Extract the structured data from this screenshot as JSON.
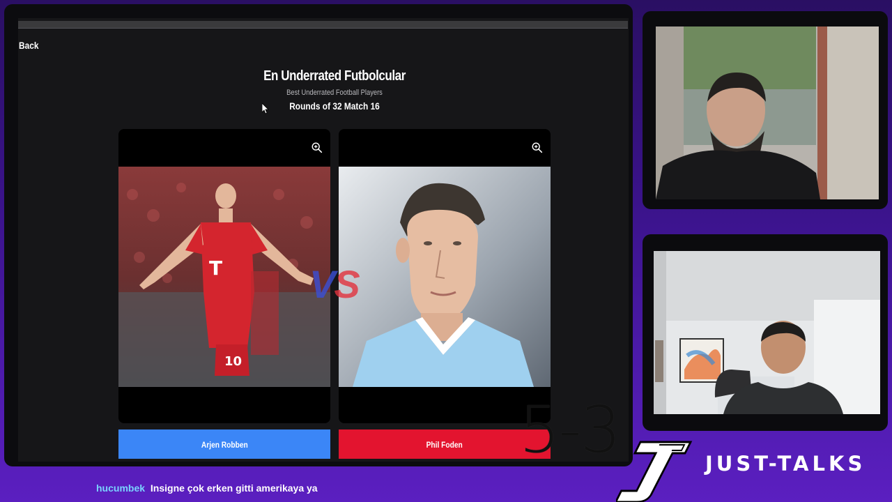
{
  "app": {
    "back_label": "Back",
    "title": "En Underrated Futbolcular",
    "subtitle": "Best Underrated Football Players",
    "round": "Rounds of 32 Match 16"
  },
  "matchup": {
    "vs_label_v": "V",
    "vs_label_s": "S",
    "left": {
      "name": "Arjen Robben",
      "color": "#3b86f7"
    },
    "right": {
      "name": "Phil Foden",
      "color": "#e3142f"
    }
  },
  "score_overlay": "5-3",
  "brand": {
    "name": "JUST-TALKS"
  },
  "chat": {
    "user": "hucumbek",
    "message": "Insigne çok erken gitti amerikaya ya"
  }
}
